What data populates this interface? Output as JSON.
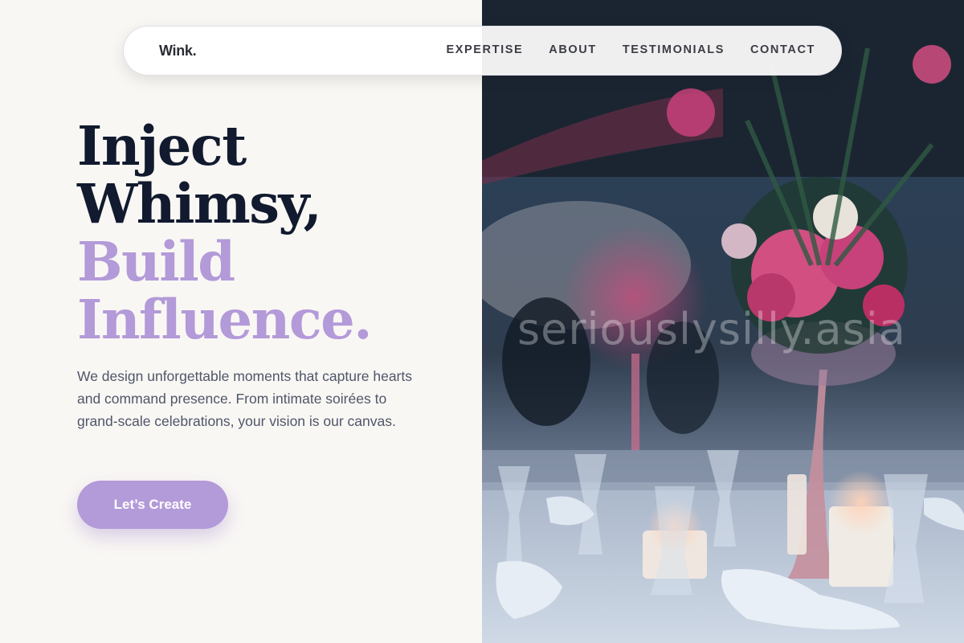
{
  "nav": {
    "logo": "Wink.",
    "links": [
      "EXPERTISE",
      "ABOUT",
      "TESTIMONIALS",
      "CONTACT"
    ]
  },
  "hero": {
    "headline": [
      "Inject",
      "Whimsy,",
      "Build",
      "Influence."
    ],
    "lede": "We design unforgettable moments that capture hearts and command presence. From intimate soirées to grand-scale celebrations, your vision is our canvas.",
    "cta_label": "Let’s Create"
  },
  "photo": {
    "watermark": "seriouslysilly.asia"
  },
  "colors": {
    "background": "#f9f7f4",
    "headline_dark": "#111a2e",
    "accent": "#b39ad8",
    "body_text": "#4f5668",
    "nav_bg": "#ffffff"
  }
}
